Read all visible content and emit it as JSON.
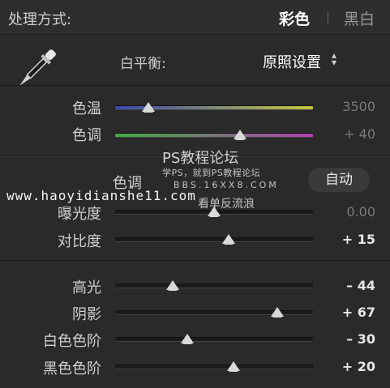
{
  "header": {
    "treatment_label": "处理方式:",
    "mode_color": "彩色",
    "mode_bw": "黑白"
  },
  "white_balance": {
    "label": "白平衡:",
    "preset": "原照设置",
    "preset_arrows": "▴▾",
    "eyedropper_icon": "eyedropper-icon",
    "sliders": [
      {
        "label": "色温",
        "value": "3500",
        "fraction": 0.17
      },
      {
        "label": "色调",
        "value": "+ 40",
        "fraction": 0.63
      }
    ]
  },
  "tone": {
    "label": "色调",
    "auto_label": "自动",
    "sliders": [
      {
        "label": "曝光度",
        "value": "0.00",
        "fraction": 0.5
      },
      {
        "label": "对比度",
        "value": "+ 15",
        "fraction": 0.575
      }
    ]
  },
  "presence": {
    "sliders": [
      {
        "label": "高光",
        "value": "– 44",
        "fraction": 0.29
      },
      {
        "label": "阴影",
        "value": "+ 67",
        "fraction": 0.82
      },
      {
        "label": "白色色阶",
        "value": "– 30",
        "fraction": 0.365
      },
      {
        "label": "黑色色阶",
        "value": "+ 20",
        "fraction": 0.6
      }
    ]
  },
  "watermark": {
    "title": "PS教程论坛",
    "subtitle": "学PS，就到PS教程论坛",
    "code": "BBS.16XX8.COM",
    "url": "www.haoyidianshe11.com",
    "tail": "看单反流浪"
  }
}
